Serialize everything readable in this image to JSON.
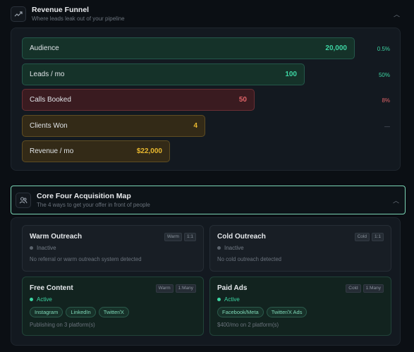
{
  "funnel": {
    "title": "Revenue Funnel",
    "subtitle": "Where leads leak out of your pipeline",
    "rows": [
      {
        "label": "Audience",
        "value": "20,000",
        "pct": "0.5%",
        "color": "green"
      },
      {
        "label": "Leads / mo",
        "value": "100",
        "pct": "50%",
        "color": "green"
      },
      {
        "label": "Calls Booked",
        "value": "50",
        "pct": "8%",
        "color": "red"
      },
      {
        "label": "Clients Won",
        "value": "4",
        "pct": "—",
        "color": "amber"
      },
      {
        "label": "Revenue / mo",
        "value": "$22,000",
        "pct": "",
        "color": "amber"
      }
    ]
  },
  "core": {
    "title": "Core Four Acquisition Map",
    "subtitle": "The 4 ways to get your offer in front of people",
    "cards": [
      {
        "title": "Warm Outreach",
        "tag1": "Warm",
        "tag2": "1:1",
        "status": "Inactive",
        "desc": "No referral or warm outreach system detected"
      },
      {
        "title": "Cold Outreach",
        "tag1": "Cold",
        "tag2": "1:1",
        "status": "Inactive",
        "desc": "No cold outreach detected"
      },
      {
        "title": "Free Content",
        "tag1": "Warm",
        "tag2": "1:Many",
        "status": "Active",
        "pills": [
          "Instagram",
          "LinkedIn",
          "Twitter/X"
        ],
        "desc": "Publishing on 3 platform(s)"
      },
      {
        "title": "Paid Ads",
        "tag1": "Cold",
        "tag2": "1:Many",
        "status": "Active",
        "pills": [
          "Facebook/Meta",
          "Twitter/X Ads"
        ],
        "desc": "$400/mo on 2 platform(s)"
      }
    ]
  }
}
